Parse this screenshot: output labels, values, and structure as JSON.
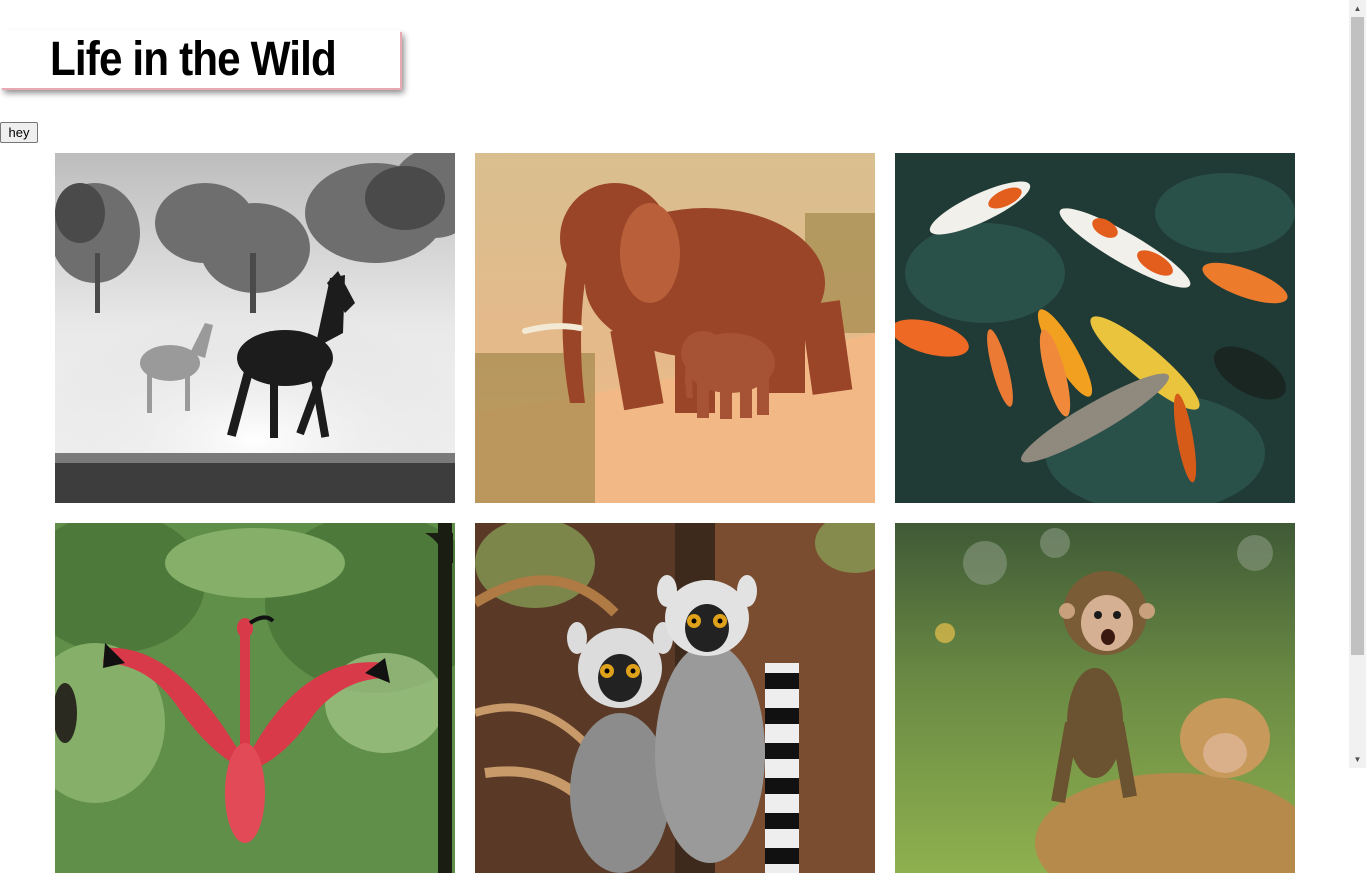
{
  "header": {
    "title": "Life in the Wild"
  },
  "controls": {
    "hey_button": "hey"
  },
  "gallery": {
    "photos": [
      {
        "name": "horses-photo",
        "subject": "two horses running through dust, black and white"
      },
      {
        "name": "elephants-photo",
        "subject": "adult elephant and calf walking on dirt road"
      },
      {
        "name": "koi-photo",
        "subject": "orange, white and yellow koi fish in dark water"
      },
      {
        "name": "ibis-photo",
        "subject": "scarlet ibis with spread wings in forest"
      },
      {
        "name": "lemurs-photo",
        "subject": "ring-tailed lemurs sitting on branches"
      },
      {
        "name": "monkey-photo",
        "subject": "baby monkey on adult monkey in grass"
      }
    ]
  },
  "colors": {
    "title_shadow": "#e8a9b3",
    "scrollbar_thumb": "#c1c1c1"
  }
}
